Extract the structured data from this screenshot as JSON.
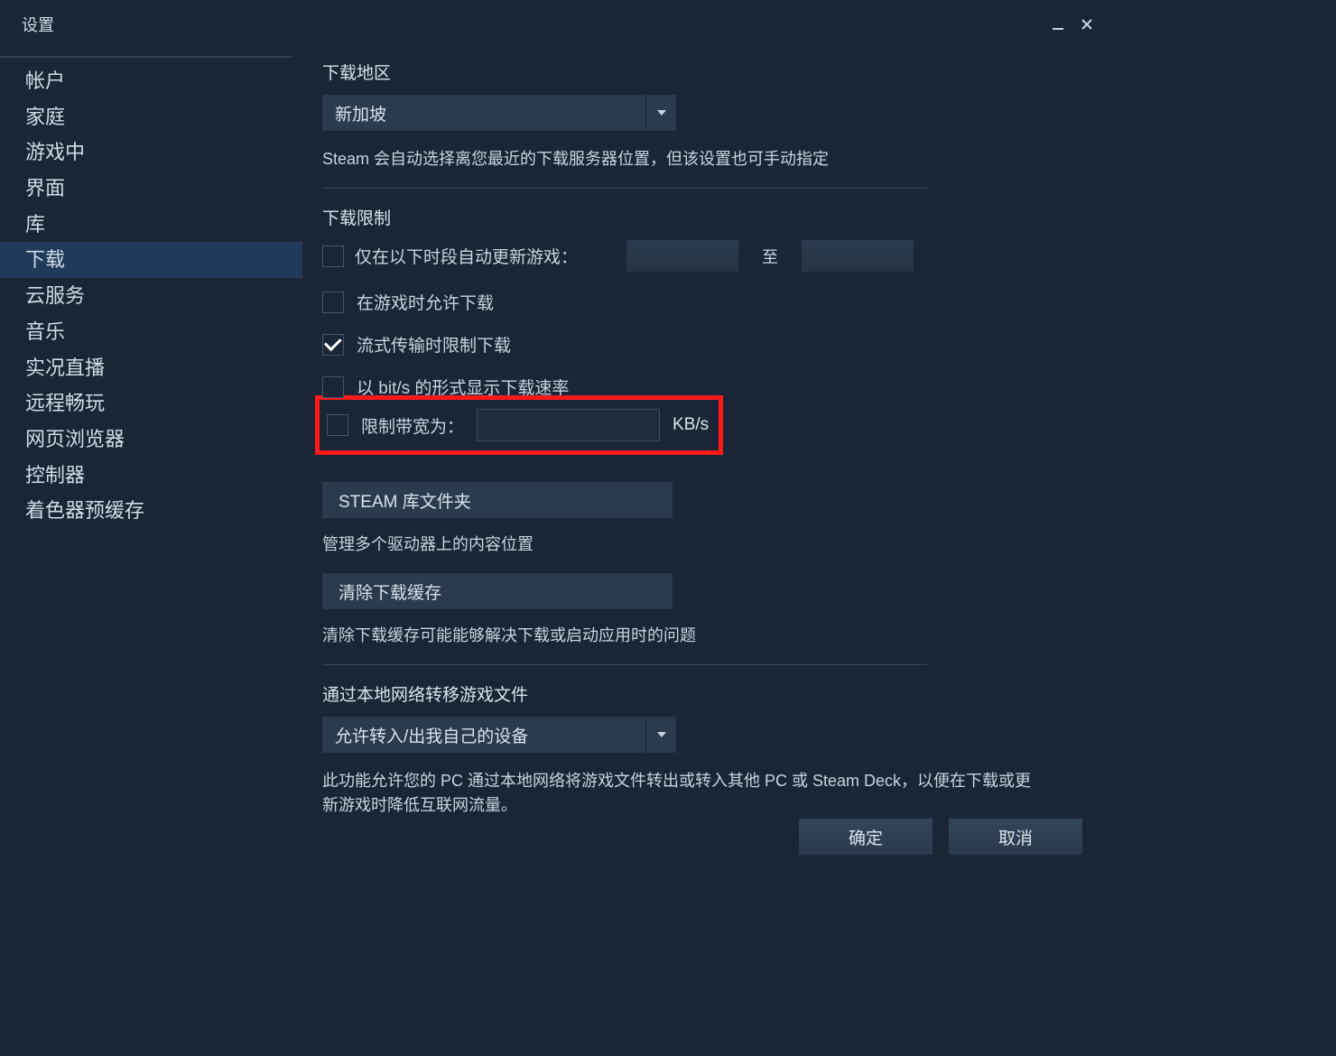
{
  "window": {
    "title": "设置"
  },
  "sidebar": {
    "items": [
      {
        "id": "account",
        "label": "帐户"
      },
      {
        "id": "family",
        "label": "家庭"
      },
      {
        "id": "in-game",
        "label": "游戏中"
      },
      {
        "id": "interface",
        "label": "界面"
      },
      {
        "id": "library",
        "label": "库"
      },
      {
        "id": "downloads",
        "label": "下载",
        "selected": true
      },
      {
        "id": "cloud",
        "label": "云服务"
      },
      {
        "id": "music",
        "label": "音乐"
      },
      {
        "id": "broadcast",
        "label": "实况直播"
      },
      {
        "id": "remote-play",
        "label": "远程畅玩"
      },
      {
        "id": "web-browser",
        "label": "网页浏览器"
      },
      {
        "id": "controller",
        "label": "控制器"
      },
      {
        "id": "shader-cache",
        "label": "着色器预缓存"
      }
    ]
  },
  "downloads": {
    "region_heading": "下载地区",
    "region_value": "新加坡",
    "region_desc": "Steam 会自动选择离您最近的下载服务器位置，但该设置也可手动指定",
    "limit_heading": "下载限制",
    "auto_update_label": "仅在以下时段自动更新游戏：",
    "to_label": "至",
    "allow_while_playing_label": "在游戏时允许下载",
    "throttle_streaming_label": "流式传输时限制下载",
    "throttle_streaming_checked": true,
    "show_bits_label": "以 bit/s 的形式显示下载速率",
    "limit_bandwidth_label": "限制带宽为：",
    "bandwidth_unit": "KB/s",
    "library_folders_button": "STEAM 库文件夹",
    "manage_content_desc": "管理多个驱动器上的内容位置",
    "clear_cache_button": "清除下载缓存",
    "clear_cache_desc": "清除下载缓存可能能够解决下载或启动应用时的问题",
    "lan_heading": "通过本地网络转移游戏文件",
    "lan_value": "允许转入/出我自己的设备",
    "lan_desc": "此功能允许您的 PC 通过本地网络将游戏文件转出或转入其他 PC 或 Steam Deck，以便在下载或更新游戏时降低互联网流量。"
  },
  "footer": {
    "ok": "确定",
    "cancel": "取消"
  }
}
